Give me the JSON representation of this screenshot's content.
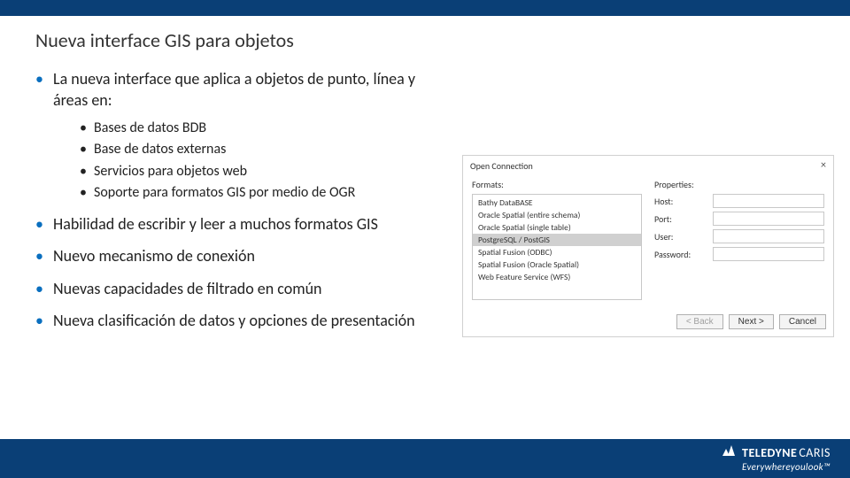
{
  "title": "Nueva interface GIS para objetos",
  "bullets": {
    "b1": "La nueva interface que aplica a objetos de punto, línea y áreas en:",
    "sub": {
      "s1": "Bases de datos BDB",
      "s2": "Base de datos externas",
      "s3": "Servicios para objetos web",
      "s4": "Soporte para formatos GIS por medio de OGR"
    },
    "b2": "Habilidad de escribir y leer a muchos formatos GIS",
    "b3": "Nuevo mecanismo de conexión",
    "b4": "Nuevas capacidades de filtrado en común",
    "b5": "Nueva clasificación de datos y opciones de presentación"
  },
  "dialog": {
    "title": "Open Connection",
    "formats_label": "Formats:",
    "properties_label": "Properties:",
    "formats": {
      "f1": "Bathy DataBASE",
      "f2": "Oracle Spatial (entire schema)",
      "f3": "Oracle Spatial (single table)",
      "f4": "PostgreSQL / PostGIS",
      "f5": "Spatial Fusion (ODBC)",
      "f6": "Spatial Fusion (Oracle Spatial)",
      "f7": "Web Feature Service (WFS)"
    },
    "props": {
      "host": "Host:",
      "port": "Port:",
      "user": "User:",
      "password": "Password:"
    },
    "buttons": {
      "back": "< Back",
      "next": "Next >",
      "cancel": "Cancel"
    }
  },
  "brand": {
    "name1": "TELEDYNE",
    "name2": "CARIS",
    "tagline": "Everywhereyoulook™"
  }
}
